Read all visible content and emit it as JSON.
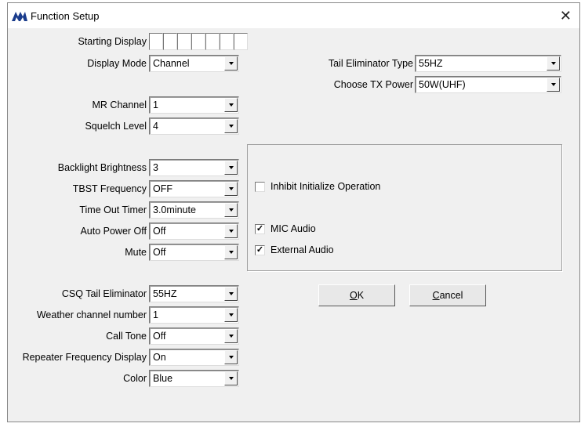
{
  "window": {
    "title": "Function Setup"
  },
  "left": [
    {
      "label": "Display Mode",
      "value": "Channel"
    },
    {
      "label": "MR Channel",
      "value": "1"
    },
    {
      "label": "Squelch Level",
      "value": "4"
    },
    {
      "label": "Backlight Brightness",
      "value": "3"
    },
    {
      "label": "TBST Frequency",
      "value": "OFF"
    },
    {
      "label": "Time Out Timer",
      "value": "3.0minute"
    },
    {
      "label": "Auto Power Off",
      "value": "Off"
    },
    {
      "label": "Mute",
      "value": "Off"
    },
    {
      "label": "CSQ Tail Eliminator",
      "value": "55HZ"
    },
    {
      "label": "Weather channel number",
      "value": "1"
    },
    {
      "label": "Call Tone",
      "value": "Off"
    },
    {
      "label": "Repeater Frequency Display",
      "value": "On"
    },
    {
      "label": "Color",
      "value": "Blue"
    }
  ],
  "starting_display": {
    "label": "Starting Display",
    "cells": [
      "",
      "",
      "",
      "",
      "",
      "",
      ""
    ]
  },
  "right": [
    {
      "label": "Tail Eliminator Type",
      "value": "55HZ"
    },
    {
      "label": "Choose TX Power",
      "value": "50W(UHF)"
    }
  ],
  "checkboxes": [
    {
      "label": "Inhibit Initialize Operation",
      "checked": false
    },
    {
      "label": "MIC Audio",
      "checked": true
    },
    {
      "label": "External Audio",
      "checked": true
    }
  ],
  "buttons": {
    "ok_mn": "O",
    "ok_rest": "K",
    "cancel_mn": "C",
    "cancel_rest": "ancel"
  }
}
